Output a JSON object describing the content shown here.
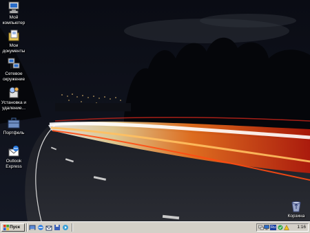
{
  "desktop": {
    "icons": [
      {
        "label": "Мой\nкомпьютер"
      },
      {
        "label": "Мои\nдокументы"
      },
      {
        "label": "Сетевое\nокружение"
      },
      {
        "label": "Установка и\nудаление..."
      },
      {
        "label": "Портфель"
      },
      {
        "label": "Outlook\nExpress"
      },
      {
        "label": "Корзина"
      }
    ]
  },
  "taskbar": {
    "start_label": "Пуск",
    "quick_launch": [
      "show-desktop-icon",
      "internet-explorer-icon",
      "outlook-icon",
      "save-icon",
      "media-icon"
    ],
    "tray": {
      "language": "Ru",
      "clock": "1:16"
    }
  },
  "colors": {
    "taskbar": "#d4d0c8",
    "sky": "#0b0d14",
    "light_trail": "#ff5a1a"
  }
}
